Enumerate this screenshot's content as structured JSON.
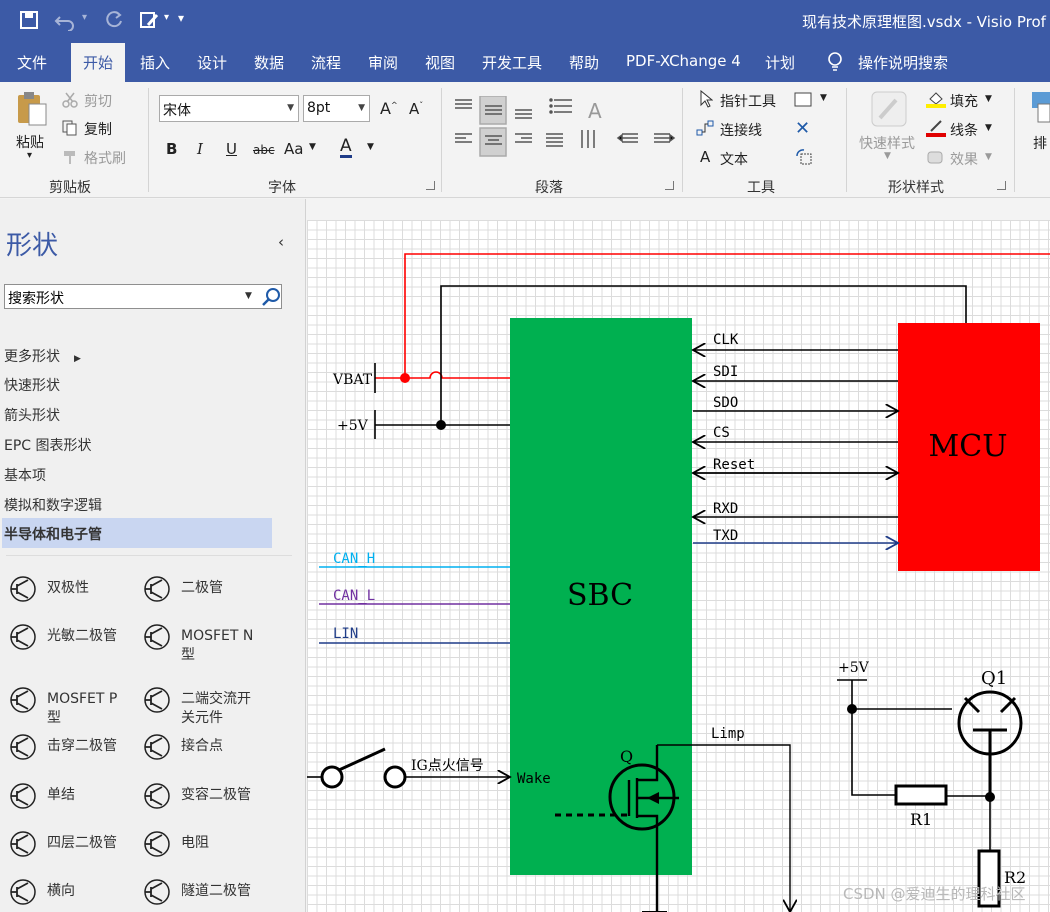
{
  "window": {
    "title": "现有技术原理框图.vsdx  -  Visio Prof"
  },
  "quick_access": {
    "items": [
      "save-icon",
      "undo-icon",
      "redo-icon",
      "format-painter-icon",
      "customize-icon"
    ]
  },
  "tabs": [
    {
      "label": "文件"
    },
    {
      "label": "开始"
    },
    {
      "label": "插入"
    },
    {
      "label": "设计"
    },
    {
      "label": "数据"
    },
    {
      "label": "流程"
    },
    {
      "label": "审阅"
    },
    {
      "label": "视图"
    },
    {
      "label": "开发工具"
    },
    {
      "label": "帮助"
    },
    {
      "label": "PDF-XChange 4"
    },
    {
      "label": "计划"
    }
  ],
  "tell_me": "操作说明搜索",
  "ribbon": {
    "clipboard": {
      "label": "剪贴板",
      "paste": "粘贴",
      "cut": "剪切",
      "copy": "复制",
      "format_painter": "格式刷"
    },
    "font": {
      "label": "字体",
      "font_name": "宋体",
      "font_size": "8pt",
      "bold": "B",
      "italic": "I",
      "underline": "U",
      "strike": "abc",
      "case": "Aa",
      "color": "A"
    },
    "paragraph": {
      "label": "段落"
    },
    "tools": {
      "label": "工具",
      "pointer": "指针工具",
      "connector": "连接线",
      "text": "文本"
    },
    "shape_styles": {
      "label": "形状样式",
      "quick_styles": "快速样式",
      "fill": "填充",
      "line": "线条",
      "effects": "效果"
    },
    "arrange": {
      "partial": "排"
    }
  },
  "shapes_panel": {
    "title": "形状",
    "search_placeholder": "搜索形状",
    "stencils": [
      "更多形状",
      "快速形状",
      "箭头形状",
      "EPC 图表形状",
      "基本项",
      "模拟和数字逻辑",
      "半导体和电子管"
    ],
    "selected_stencil": "半导体和电子管",
    "shapes": [
      {
        "label": "双极性",
        "icon": "bjt-icon"
      },
      {
        "label": "二极管",
        "icon": "diode-icon"
      },
      {
        "label": "光敏二极管",
        "icon": "photodiode-icon"
      },
      {
        "label": "MOSFET N\n型",
        "icon": "mosfet-n-icon"
      },
      {
        "label": "MOSFET P\n型",
        "icon": "mosfet-p-icon"
      },
      {
        "label": "二端交流开\n关元件",
        "icon": "diac-icon"
      },
      {
        "label": "击穿二极管",
        "icon": "zener-icon"
      },
      {
        "label": "接合点",
        "icon": "junction-icon"
      },
      {
        "label": "单结",
        "icon": "ujt-icon"
      },
      {
        "label": "变容二极管",
        "icon": "varactor-icon"
      },
      {
        "label": "四层二极管",
        "icon": "four-layer-diode-icon"
      },
      {
        "label": "电阻",
        "icon": "resistor-icon"
      },
      {
        "label": "横向",
        "icon": "lateral-icon"
      },
      {
        "label": "隧道二极管",
        "icon": "tunnel-diode-icon"
      }
    ]
  },
  "diagram": {
    "sbc_label": "SBC",
    "mcu_label": "MCU",
    "vbat": "VBAT",
    "v5": "+5V",
    "signals_mcu": [
      "CLK",
      "SDI",
      "SDO",
      "CS",
      "Reset",
      "RXD",
      "TXD"
    ],
    "can_h": "CAN_H",
    "can_l": "CAN_L",
    "lin": "LIN",
    "ig": "IG点火信号",
    "wake": "Wake",
    "q": "Q",
    "limp": "Limp",
    "q1_supply": "+5V",
    "q1": "Q1",
    "r1": "R1",
    "r2": "R2",
    "colors": {
      "sbc": "#00b050",
      "mcu": "#ff0000",
      "vbat_line": "#ff0000",
      "can_h": "#00b0f0",
      "can_l": "#7030a0",
      "lin": "#1f3c88",
      "txd": "#1f3c88"
    }
  },
  "watermark": "CSDN @爱迪生的理科社区"
}
